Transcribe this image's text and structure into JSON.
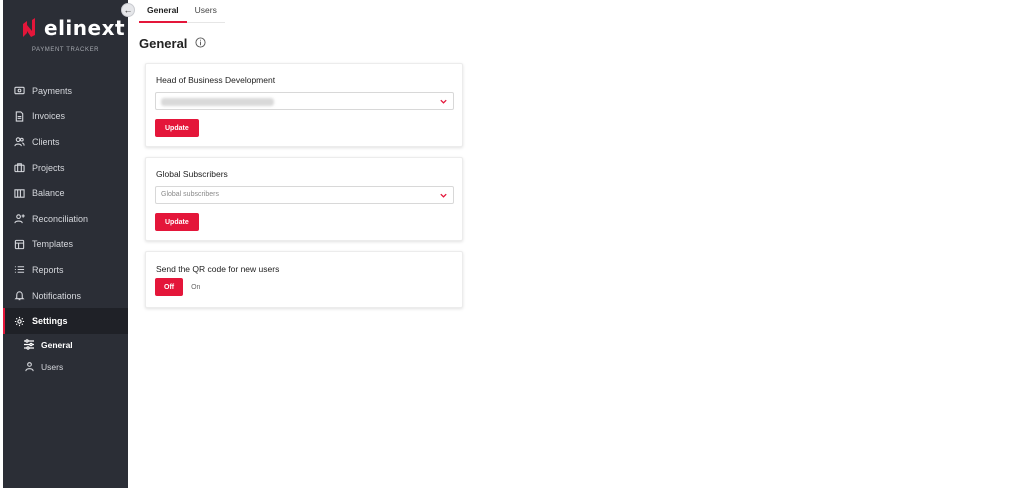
{
  "brand": {
    "name": "elinext",
    "subtitle": "PAYMENT TRACKER",
    "accent_color": "#e4163a",
    "sidebar_color": "#2b2e36"
  },
  "sidebar": {
    "items": [
      {
        "label": "Payments",
        "icon": "payments-icon"
      },
      {
        "label": "Invoices",
        "icon": "invoice-icon"
      },
      {
        "label": "Clients",
        "icon": "clients-icon"
      },
      {
        "label": "Projects",
        "icon": "briefcase-icon"
      },
      {
        "label": "Balance",
        "icon": "balance-icon"
      },
      {
        "label": "Reconciliation",
        "icon": "reconciliation-icon"
      },
      {
        "label": "Templates",
        "icon": "templates-icon"
      },
      {
        "label": "Reports",
        "icon": "reports-icon"
      },
      {
        "label": "Notifications",
        "icon": "bell-icon"
      },
      {
        "label": "Settings",
        "icon": "gear-icon",
        "active": true
      }
    ],
    "sub_items": [
      {
        "label": "General",
        "icon": "sliders-icon",
        "active": true
      },
      {
        "label": "Users",
        "icon": "user-icon"
      }
    ]
  },
  "tabs": [
    {
      "label": "General",
      "active": true
    },
    {
      "label": "Users"
    }
  ],
  "page": {
    "title": "General"
  },
  "cards": {
    "head_bd": {
      "title": "Head of Business Development",
      "select_value": "",
      "button": "Update"
    },
    "subscribers": {
      "title": "Global Subscribers",
      "placeholder": "Global subscribers",
      "button": "Update"
    },
    "qr": {
      "title": "Send the QR code for new users",
      "off_label": "Off",
      "on_label": "On",
      "selected": "Off"
    }
  }
}
